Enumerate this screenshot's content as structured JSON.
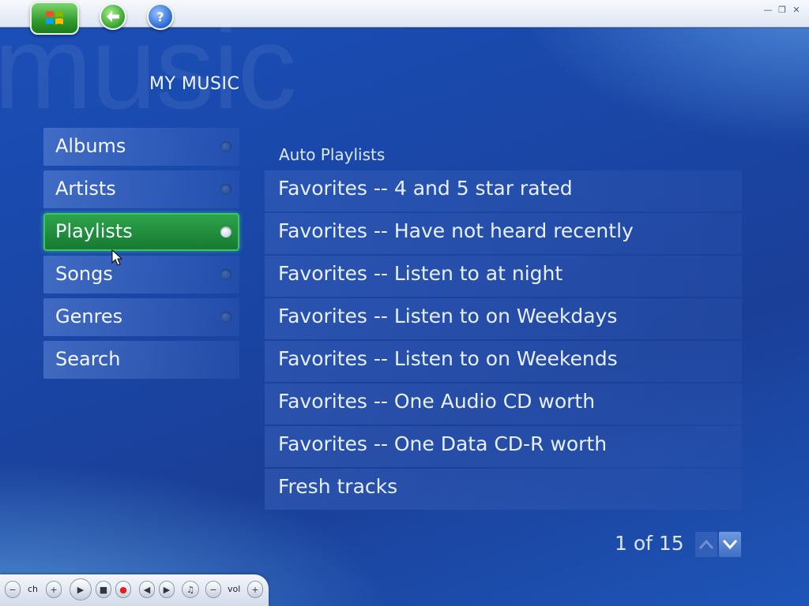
{
  "window": {
    "watermark": "music",
    "page_title": "MY MUSIC",
    "controls": [
      "minimize",
      "restore",
      "close"
    ]
  },
  "toolbar": {
    "start_icon": "windows-flag-icon",
    "back_icon": "back-arrow-icon",
    "help_icon": "help-icon"
  },
  "menu": {
    "items": [
      {
        "label": "Albums"
      },
      {
        "label": "Artists"
      },
      {
        "label": "Playlists",
        "selected": true
      },
      {
        "label": "Songs"
      },
      {
        "label": "Genres"
      },
      {
        "label": "Search"
      }
    ]
  },
  "content": {
    "section_label": "Auto Playlists",
    "rows": [
      {
        "label": "Favorites -- 4 and 5 star rated"
      },
      {
        "label": "Favorites -- Have not heard recently"
      },
      {
        "label": "Favorites -- Listen to at night"
      },
      {
        "label": "Favorites -- Listen to on Weekdays"
      },
      {
        "label": "Favorites -- Listen to on Weekends"
      },
      {
        "label": "Favorites -- One Audio CD worth"
      },
      {
        "label": "Favorites -- One Data CD-R worth"
      },
      {
        "label": "Fresh tracks"
      }
    ],
    "pager": "1 of 15"
  },
  "transport": {
    "ch_label": "ch",
    "vol_label": "vol"
  }
}
